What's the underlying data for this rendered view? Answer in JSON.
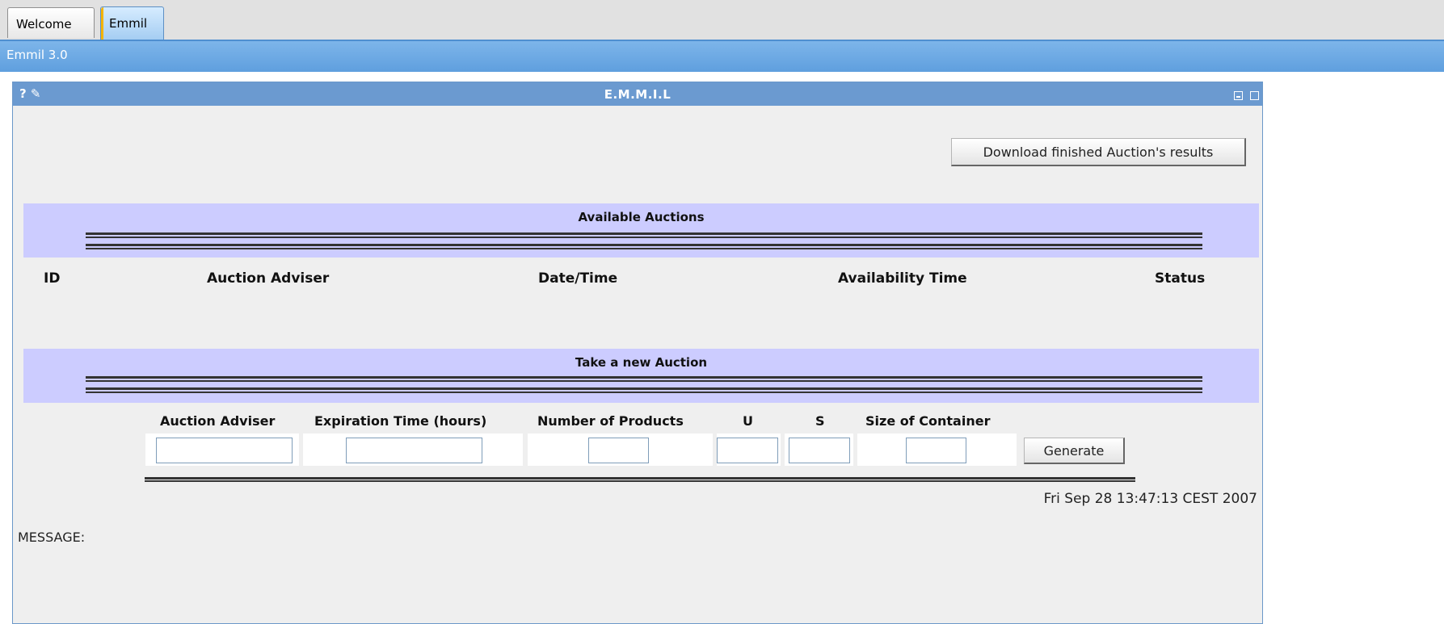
{
  "tabs": [
    {
      "label": "Welcome"
    },
    {
      "label": "Emmil"
    }
  ],
  "app_title": "Emmil 3.0",
  "panel": {
    "left_controls": "? ✎",
    "title": "E.M.M.I.L",
    "download_button": "Download finished Auction's results"
  },
  "available": {
    "title": "Available Auctions",
    "columns": [
      "ID",
      "Auction Adviser",
      "Date/Time",
      "Availability Time",
      "Status"
    ]
  },
  "new_auction": {
    "title": "Take a new Auction",
    "fields": [
      "Auction Adviser",
      "Expiration Time (hours)",
      "Number of Products",
      "U",
      "S",
      "Size of Container"
    ],
    "generate_button": "Generate"
  },
  "datetime": "Fri Sep 28 13:47:13 CEST 2007",
  "message_label": "MESSAGE:"
}
